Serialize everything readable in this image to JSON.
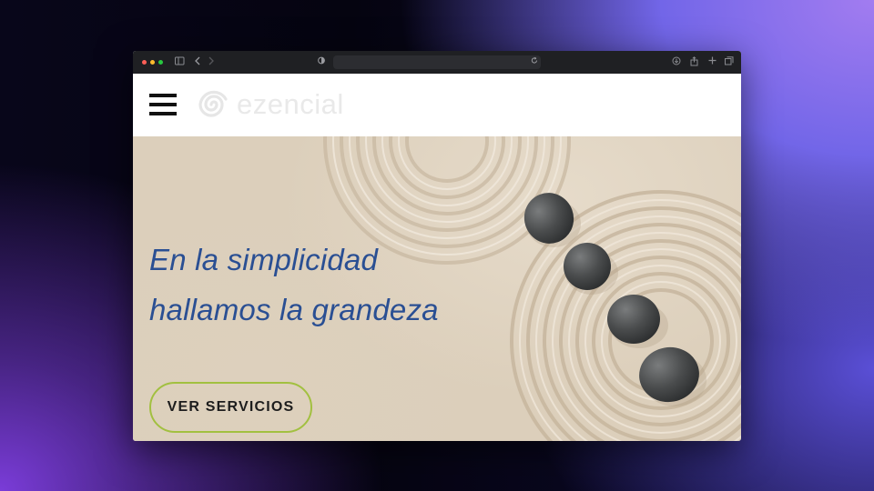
{
  "browser": {
    "traffic_colors": [
      "#ff5f57",
      "#febc2e",
      "#28c840"
    ],
    "icons": [
      "sidebar-icon",
      "back-icon",
      "forward-icon",
      "shield-icon",
      "reload-icon",
      "download-icon",
      "share-icon",
      "new-tab-icon",
      "tabs-overview-icon"
    ]
  },
  "header": {
    "logo_text": "ezencial",
    "menu_icon": "hamburger-icon"
  },
  "hero": {
    "headline_line1": "En la simplicidad",
    "headline_line2": "hallamos la grandeza",
    "cta_label": "VER SERVICIOS",
    "headline_color": "#2a4f93",
    "cta_border_color": "#a2c040"
  }
}
